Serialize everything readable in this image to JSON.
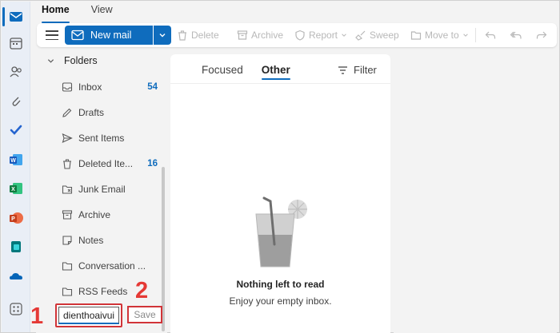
{
  "colors": {
    "accent": "#0f6cbd",
    "highlight_red": "#d13438",
    "step_red": "#e53935"
  },
  "app_rail": [
    {
      "name": "mail-icon",
      "active": true
    },
    {
      "name": "calendar-icon"
    },
    {
      "name": "people-icon"
    },
    {
      "name": "attachment-icon"
    },
    {
      "name": "todo-icon"
    },
    {
      "name": "word-icon"
    },
    {
      "name": "excel-icon"
    },
    {
      "name": "powerpoint-icon"
    },
    {
      "name": "bookings-icon"
    },
    {
      "name": "onedrive-icon"
    },
    {
      "name": "more-apps-icon"
    }
  ],
  "ribbon": {
    "tabs": [
      "Home",
      "View"
    ]
  },
  "toolbar": {
    "new_mail_label": "New mail",
    "delete_label": "Delete",
    "archive_label": "Archive",
    "report_label": "Report",
    "sweep_label": "Sweep",
    "move_to_label": "Move to"
  },
  "folder_pane": {
    "header": "Folders",
    "items": [
      {
        "label": "Inbox",
        "count": "54",
        "icon": "inbox-icon"
      },
      {
        "label": "Drafts",
        "count": "",
        "icon": "drafts-icon"
      },
      {
        "label": "Sent Items",
        "count": "",
        "icon": "sent-icon"
      },
      {
        "label": "Deleted Ite...",
        "count": "16",
        "icon": "trash-icon"
      },
      {
        "label": "Junk Email",
        "count": "",
        "icon": "junk-icon"
      },
      {
        "label": "Archive",
        "count": "",
        "icon": "archive-icon"
      },
      {
        "label": "Notes",
        "count": "",
        "icon": "notes-icon"
      },
      {
        "label": "Conversation ...",
        "count": "",
        "icon": "folder-icon"
      },
      {
        "label": "RSS Feeds",
        "count": "",
        "icon": "folder-icon"
      }
    ],
    "new_folder_value": "dienthoaivui",
    "save_label": "Save"
  },
  "annotations": {
    "step1": "1",
    "step2": "2"
  },
  "message_list": {
    "tabs": [
      "Focused",
      "Other"
    ],
    "active_tab": "Other",
    "filter_label": "Filter",
    "empty_title": "Nothing left to read",
    "empty_subtitle": "Enjoy your empty inbox."
  }
}
